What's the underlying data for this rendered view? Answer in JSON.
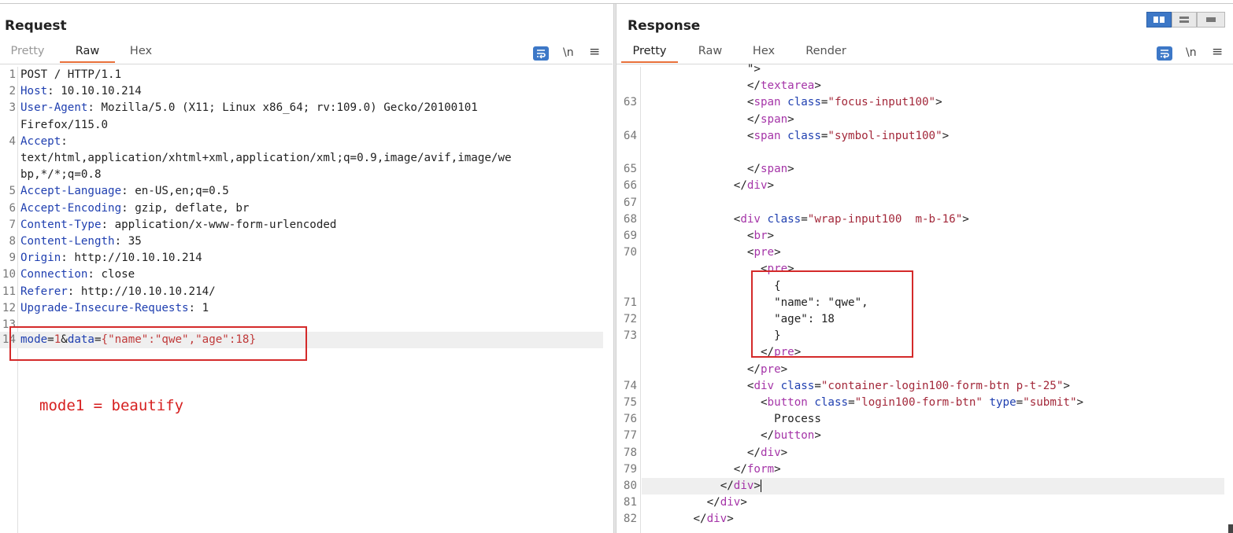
{
  "request": {
    "title": "Request",
    "tabs": [
      {
        "label": "Pretty",
        "active": false
      },
      {
        "label": "Raw",
        "active": true
      },
      {
        "label": "Hex",
        "active": false
      }
    ],
    "toolbar": {
      "newline_label": "\\n",
      "menu_label": "≡"
    },
    "lines": [
      {
        "n": "1",
        "name": "",
        "sep": "",
        "value": "POST / HTTP/1.1"
      },
      {
        "n": "2",
        "name": "Host",
        "sep": ": ",
        "value": "10.10.10.214"
      },
      {
        "n": "3",
        "name": "User-Agent",
        "sep": ": ",
        "value": "Mozilla/5.0 (X11; Linux x86_64; rv:109.0) Gecko/20100101"
      },
      {
        "n": "",
        "name": "",
        "sep": "",
        "value": "Firefox/115.0"
      },
      {
        "n": "4",
        "name": "Accept",
        "sep": ":",
        "value": ""
      },
      {
        "n": "",
        "name": "",
        "sep": "",
        "value": "text/html,application/xhtml+xml,application/xml;q=0.9,image/avif,image/we"
      },
      {
        "n": "",
        "name": "",
        "sep": "",
        "value": "bp,*/*;q=0.8"
      },
      {
        "n": "5",
        "name": "Accept-Language",
        "sep": ": ",
        "value": "en-US,en;q=0.5"
      },
      {
        "n": "6",
        "name": "Accept-Encoding",
        "sep": ": ",
        "value": "gzip, deflate, br"
      },
      {
        "n": "7",
        "name": "Content-Type",
        "sep": ": ",
        "value": "application/x-www-form-urlencoded"
      },
      {
        "n": "8",
        "name": "Content-Length",
        "sep": ": ",
        "value": "35"
      },
      {
        "n": "9",
        "name": "Origin",
        "sep": ": ",
        "value": "http://10.10.10.214"
      },
      {
        "n": "10",
        "name": "Connection",
        "sep": ": ",
        "value": "close"
      },
      {
        "n": "11",
        "name": "Referer",
        "sep": ": ",
        "value": "http://10.10.10.214/"
      },
      {
        "n": "12",
        "name": "Upgrade-Insecure-Requests",
        "sep": ": ",
        "value": "1"
      },
      {
        "n": "13",
        "name": "",
        "sep": "",
        "value": ""
      }
    ],
    "body_line": {
      "n": "14",
      "p1_name": "mode",
      "eq1": "=",
      "p1_val": "1",
      "amp": "&",
      "p2_name": "data",
      "eq2": "=",
      "p2_val": "{\"name\":\"qwe\",\"age\":18}"
    },
    "annotation": "mode1 = beautify"
  },
  "response": {
    "title": "Response",
    "tabs": [
      {
        "label": "Pretty",
        "active": true
      },
      {
        "label": "Raw",
        "active": false
      },
      {
        "label": "Hex",
        "active": false
      },
      {
        "label": "Render",
        "active": false
      }
    ],
    "toolbar": {
      "newline_label": "\\n",
      "menu_label": "≡"
    },
    "lines": [
      {
        "n": "",
        "indent": 9,
        "parts": [
          [
            "br",
            "\">"
          ]
        ]
      },
      {
        "n": "",
        "indent": 9,
        "parts": [
          [
            "br",
            "</"
          ],
          [
            "tag",
            "textarea"
          ],
          [
            "br",
            ">"
          ]
        ]
      },
      {
        "n": "63",
        "indent": 9,
        "parts": [
          [
            "br",
            "<"
          ],
          [
            "tag",
            "span"
          ],
          [
            "br",
            " "
          ],
          [
            "attr",
            "class"
          ],
          [
            "br",
            "="
          ],
          [
            "str",
            "\"focus-input100\""
          ],
          [
            "br",
            ">"
          ]
        ]
      },
      {
        "n": "",
        "indent": 9,
        "parts": [
          [
            "br",
            "</"
          ],
          [
            "tag",
            "span"
          ],
          [
            "br",
            ">"
          ]
        ]
      },
      {
        "n": "64",
        "indent": 9,
        "parts": [
          [
            "br",
            "<"
          ],
          [
            "tag",
            "span"
          ],
          [
            "br",
            " "
          ],
          [
            "attr",
            "class"
          ],
          [
            "br",
            "="
          ],
          [
            "str",
            "\"symbol-input100\""
          ],
          [
            "br",
            ">"
          ]
        ]
      },
      {
        "n": "",
        "indent": 9,
        "parts": []
      },
      {
        "n": "65",
        "indent": 9,
        "parts": [
          [
            "br",
            "</"
          ],
          [
            "tag",
            "span"
          ],
          [
            "br",
            ">"
          ]
        ]
      },
      {
        "n": "66",
        "indent": 8,
        "parts": [
          [
            "br",
            "</"
          ],
          [
            "tag",
            "div"
          ],
          [
            "br",
            ">"
          ]
        ]
      },
      {
        "n": "67",
        "indent": 8,
        "parts": []
      },
      {
        "n": "68",
        "indent": 8,
        "parts": [
          [
            "br",
            "<"
          ],
          [
            "tag",
            "div"
          ],
          [
            "br",
            " "
          ],
          [
            "attr",
            "class"
          ],
          [
            "br",
            "="
          ],
          [
            "str",
            "\"wrap-input100  m-b-16\""
          ],
          [
            "br",
            ">"
          ]
        ]
      },
      {
        "n": "69",
        "indent": 9,
        "parts": [
          [
            "br",
            "<"
          ],
          [
            "tag",
            "br"
          ],
          [
            "br",
            ">"
          ]
        ]
      },
      {
        "n": "70",
        "indent": 9,
        "parts": [
          [
            "br",
            "<"
          ],
          [
            "tag",
            "pre"
          ],
          [
            "br",
            ">"
          ]
        ]
      },
      {
        "n": "",
        "indent": 10,
        "parts": [
          [
            "br",
            "<"
          ],
          [
            "tag",
            "pre"
          ],
          [
            "br",
            ">"
          ]
        ]
      },
      {
        "n": "",
        "indent": 11,
        "parts": [
          [
            "br",
            "{"
          ]
        ]
      },
      {
        "n": "71",
        "indent": 11,
        "parts": [
          [
            "br",
            "\"name\": \"qwe\","
          ]
        ]
      },
      {
        "n": "72",
        "indent": 11,
        "parts": [
          [
            "br",
            "\"age\": 18"
          ]
        ]
      },
      {
        "n": "73",
        "indent": 11,
        "parts": [
          [
            "br",
            "}"
          ]
        ]
      },
      {
        "n": "",
        "indent": 10,
        "parts": [
          [
            "br",
            "</"
          ],
          [
            "tag",
            "pre"
          ],
          [
            "br",
            ">"
          ]
        ]
      },
      {
        "n": "",
        "indent": 9,
        "parts": [
          [
            "br",
            "</"
          ],
          [
            "tag",
            "pre"
          ],
          [
            "br",
            ">"
          ]
        ]
      },
      {
        "n": "74",
        "indent": 9,
        "parts": [
          [
            "br",
            "<"
          ],
          [
            "tag",
            "div"
          ],
          [
            "br",
            " "
          ],
          [
            "attr",
            "class"
          ],
          [
            "br",
            "="
          ],
          [
            "str",
            "\"container-login100-form-btn p-t-25\""
          ],
          [
            "br",
            ">"
          ]
        ]
      },
      {
        "n": "75",
        "indent": 10,
        "parts": [
          [
            "br",
            "<"
          ],
          [
            "tag",
            "button"
          ],
          [
            "br",
            " "
          ],
          [
            "attr",
            "class"
          ],
          [
            "br",
            "="
          ],
          [
            "str",
            "\"login100-form-btn\""
          ],
          [
            "br",
            " "
          ],
          [
            "attr",
            "type"
          ],
          [
            "br",
            "="
          ],
          [
            "str",
            "\"submit\""
          ],
          [
            "br",
            ">"
          ]
        ]
      },
      {
        "n": "76",
        "indent": 11,
        "parts": [
          [
            "br",
            "Process"
          ]
        ]
      },
      {
        "n": "77",
        "indent": 10,
        "parts": [
          [
            "br",
            "</"
          ],
          [
            "tag",
            "button"
          ],
          [
            "br",
            ">"
          ]
        ]
      },
      {
        "n": "78",
        "indent": 9,
        "parts": [
          [
            "br",
            "</"
          ],
          [
            "tag",
            "div"
          ],
          [
            "br",
            ">"
          ]
        ]
      },
      {
        "n": "79",
        "indent": 8,
        "parts": [
          [
            "br",
            "</"
          ],
          [
            "tag",
            "form"
          ],
          [
            "br",
            ">"
          ]
        ]
      },
      {
        "n": "80",
        "indent": 7,
        "parts": [
          [
            "br",
            "</"
          ],
          [
            "tag",
            "div"
          ],
          [
            "br",
            ">"
          ]
        ],
        "cursor": true
      },
      {
        "n": "81",
        "indent": 6,
        "parts": [
          [
            "br",
            "</"
          ],
          [
            "tag",
            "div"
          ],
          [
            "br",
            ">"
          ]
        ]
      },
      {
        "n": "82",
        "indent": 5,
        "parts": [
          [
            "br",
            "</"
          ],
          [
            "tag",
            "div"
          ],
          [
            "br",
            ">"
          ]
        ]
      }
    ]
  },
  "colors": {
    "accent_tab_underline": "#e8703a",
    "highlight_box": "#d42a2a",
    "annotation_text": "#d62020",
    "header_name": "#1f3fb0",
    "tag": "#a535a8",
    "string": "#a3283a",
    "toolbar_blue": "#3d78c7"
  }
}
